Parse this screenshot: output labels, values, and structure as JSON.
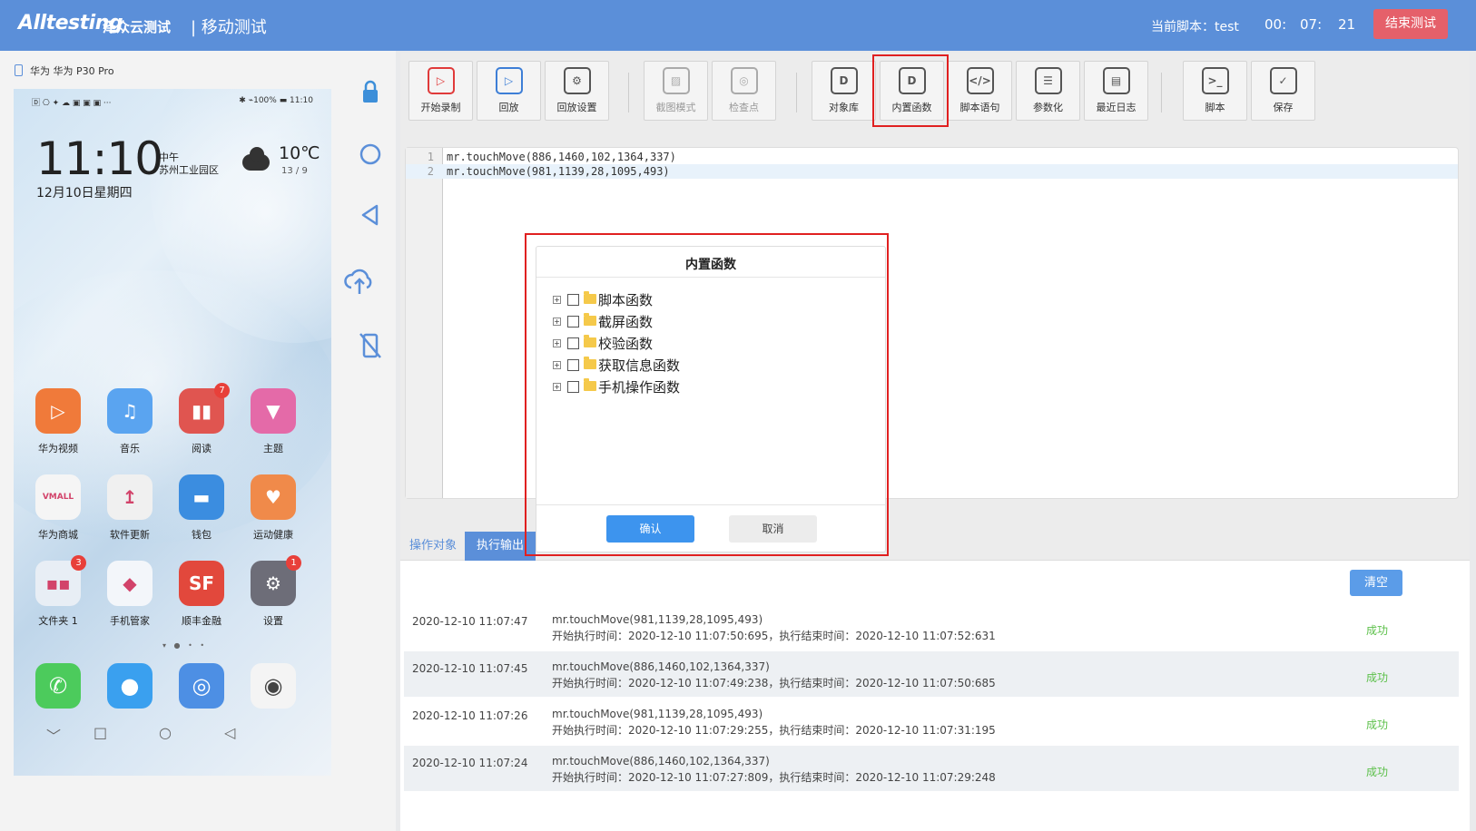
{
  "header": {
    "logo": "Alltesting",
    "logo_cn": "泽众云测试",
    "module": "| 移动测试",
    "current_script": "当前脚本：test",
    "timer": [
      "00:",
      "07:",
      "21"
    ],
    "end_button": "结束测试"
  },
  "device": {
    "name": "华为 华为 P30 Pro",
    "status_left": "🄳 ⎔ ✦ ☁ ▣ ▣ ▣ ···",
    "status_right": "✱ ⌁100% ▬ 11:10",
    "clock": "11:10",
    "noon": "中午",
    "place": "苏州工业园区",
    "date": "12月10日星期四",
    "temp": "10℃",
    "temp_range": "13 / 9",
    "apps": [
      {
        "label": "华为视频",
        "color": "#f07a3a",
        "glyph": "▷",
        "badge": ""
      },
      {
        "label": "音乐",
        "color": "#5aa4f0",
        "glyph": "♫",
        "badge": ""
      },
      {
        "label": "阅读",
        "color": "#e05550",
        "glyph": "▮▮",
        "badge": "7"
      },
      {
        "label": "主题",
        "color": "#e46aa8",
        "glyph": "▼",
        "badge": ""
      },
      {
        "label": "华为商城",
        "color": "#f5f5f5",
        "glyph": "VMALL",
        "badge": ""
      },
      {
        "label": "软件更新",
        "color": "#f0f0f0",
        "glyph": "↥",
        "badge": ""
      },
      {
        "label": "钱包",
        "color": "#3b8de0",
        "glyph": "▬",
        "badge": ""
      },
      {
        "label": "运动健康",
        "color": "#f08a4a",
        "glyph": "♥",
        "badge": ""
      },
      {
        "label": "文件夹 1",
        "color": "#e8eef5",
        "glyph": "▪▪",
        "badge": "3"
      },
      {
        "label": "手机管家",
        "color": "#f3f6fa",
        "glyph": "◆",
        "badge": ""
      },
      {
        "label": "顺丰金融",
        "color": "#e2483c",
        "glyph": "SF",
        "badge": ""
      },
      {
        "label": "设置",
        "color": "#6d6d78",
        "glyph": "⚙",
        "badge": "1"
      }
    ],
    "dock": [
      {
        "label": "phone",
        "color": "#4ccb5c",
        "glyph": "✆"
      },
      {
        "label": "messages",
        "color": "#3aa0ef",
        "glyph": "●"
      },
      {
        "label": "browser",
        "color": "#4d8fe4",
        "glyph": "◎"
      },
      {
        "label": "camera",
        "color": "#f4f4f4",
        "glyph": "◉"
      }
    ],
    "page_dots": "▾ ● • •",
    "nav": [
      "﹀",
      "□",
      "○",
      "◁"
    ]
  },
  "toolbar": [
    {
      "label": "开始录制",
      "icon": "▷",
      "style": "red",
      "disabled": false
    },
    {
      "label": "回放",
      "icon": "▷",
      "style": "blue",
      "disabled": false
    },
    {
      "label": "回放设置",
      "icon": "⚙",
      "style": "",
      "disabled": false
    },
    {
      "label": "截图模式",
      "icon": "▨",
      "style": "",
      "disabled": true
    },
    {
      "label": "检查点",
      "icon": "◎",
      "style": "",
      "disabled": true
    },
    {
      "label": "对象库",
      "icon": "D",
      "style": "",
      "disabled": false
    },
    {
      "label": "内置函数",
      "icon": "D",
      "style": "",
      "disabled": false
    },
    {
      "label": "脚本语句",
      "icon": "</>",
      "style": "",
      "disabled": false
    },
    {
      "label": "参数化",
      "icon": "☰",
      "style": "",
      "disabled": false
    },
    {
      "label": "最近日志",
      "icon": "▤",
      "style": "",
      "disabled": false
    },
    {
      "label": "脚本",
      "icon": ">_",
      "style": "",
      "disabled": false
    },
    {
      "label": "保存",
      "icon": "✓",
      "style": "",
      "disabled": false
    }
  ],
  "editor": {
    "lines": [
      {
        "n": "1",
        "code": "mr.touchMove(886,1460,102,1364,337)"
      },
      {
        "n": "2",
        "code": "mr.touchMove(981,1139,28,1095,493)"
      }
    ]
  },
  "tabs": {
    "objects": "操作对象",
    "output": "执行输出"
  },
  "output": {
    "clear": "清空",
    "rows": [
      {
        "ts": "2020-12-10 11:07:47",
        "cmd": "mr.touchMove(981,1139,28,1095,493)",
        "detail": "开始执行时间：2020-12-10 11:07:50:695，执行结束时间：2020-12-10 11:07:52:631",
        "status": "成功"
      },
      {
        "ts": "2020-12-10 11:07:45",
        "cmd": "mr.touchMove(886,1460,102,1364,337)",
        "detail": "开始执行时间：2020-12-10 11:07:49:238，执行结束时间：2020-12-10 11:07:50:685",
        "status": "成功"
      },
      {
        "ts": "2020-12-10 11:07:26",
        "cmd": "mr.touchMove(981,1139,28,1095,493)",
        "detail": "开始执行时间：2020-12-10 11:07:29:255，执行结束时间：2020-12-10 11:07:31:195",
        "status": "成功"
      },
      {
        "ts": "2020-12-10 11:07:24",
        "cmd": "mr.touchMove(886,1460,102,1364,337)",
        "detail": "开始执行时间：2020-12-10 11:07:27:809，执行结束时间：2020-12-10 11:07:29:248",
        "status": "成功"
      }
    ]
  },
  "modal": {
    "title": "内置函数",
    "nodes": [
      "脚本函数",
      "截屏函数",
      "校验函数",
      "获取信息函数",
      "手机操作函数"
    ],
    "ok": "确认",
    "cancel": "取消"
  }
}
